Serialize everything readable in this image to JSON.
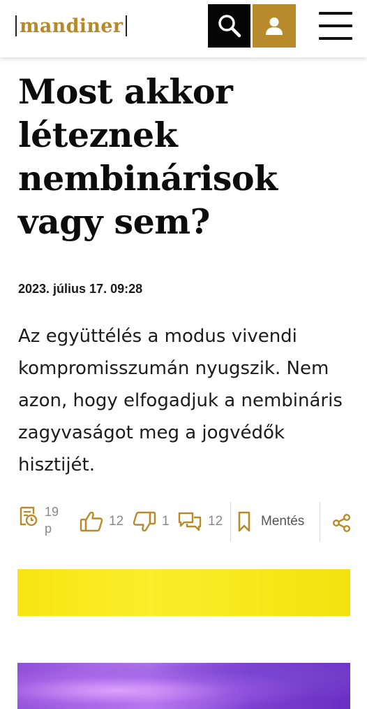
{
  "header": {
    "logo_text": "mandiner",
    "search_icon": "search-icon",
    "profile_icon": "user-icon",
    "menu_icon": "hamburger-menu-icon"
  },
  "article": {
    "title": "Most akkor léteznek nembinárisok vagy sem?",
    "date": "2023. július 17. 09:28",
    "lead": "Az együttélés a modus vivendi kompromisszumán nyugszik. Nem azon, hogy elfogadjuk a nembináris zagyvaságot meg a jogvédők hisztijét."
  },
  "actions": {
    "read_time": "19 p",
    "likes": "12",
    "dislikes": "1",
    "comments": "12",
    "save_label": "Mentés"
  },
  "colors": {
    "brand_gold": "#b78a2b",
    "black": "#050505",
    "flag_yellow": "#f7e412",
    "flag_purple": "#8f4fd8"
  }
}
